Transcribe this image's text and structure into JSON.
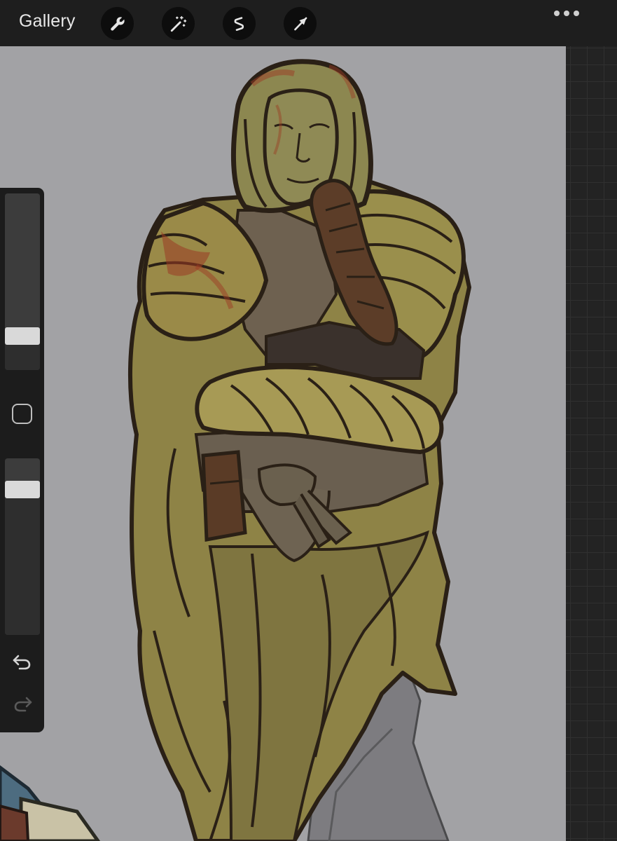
{
  "toolbar": {
    "gallery_label": "Gallery",
    "tools": [
      {
        "name": "actions",
        "icon": "wrench-icon"
      },
      {
        "name": "adjustments",
        "icon": "magic-wand-icon"
      },
      {
        "name": "selection",
        "icon": "selection-s-icon"
      },
      {
        "name": "transform",
        "icon": "arrow-cursor-icon"
      }
    ],
    "more_icon": "ellipsis-icon"
  },
  "sidebar": {
    "brush_size_level": 0.16,
    "opacity_level": 0.86,
    "modify_icon": "square-modify-icon",
    "undo_icon": "undo-arrow-icon",
    "redo_icon": "redo-arrow-icon"
  },
  "colors": {
    "toolbar_bg": "#1e1e1e",
    "canvas_bg": "#a2a2a5",
    "robe": "#8e8346",
    "robe_light": "#a79a55",
    "shadow": "#3a312c",
    "outline": "#2a2016",
    "leather": "#5a3b26",
    "blood": "#9b3b24"
  }
}
